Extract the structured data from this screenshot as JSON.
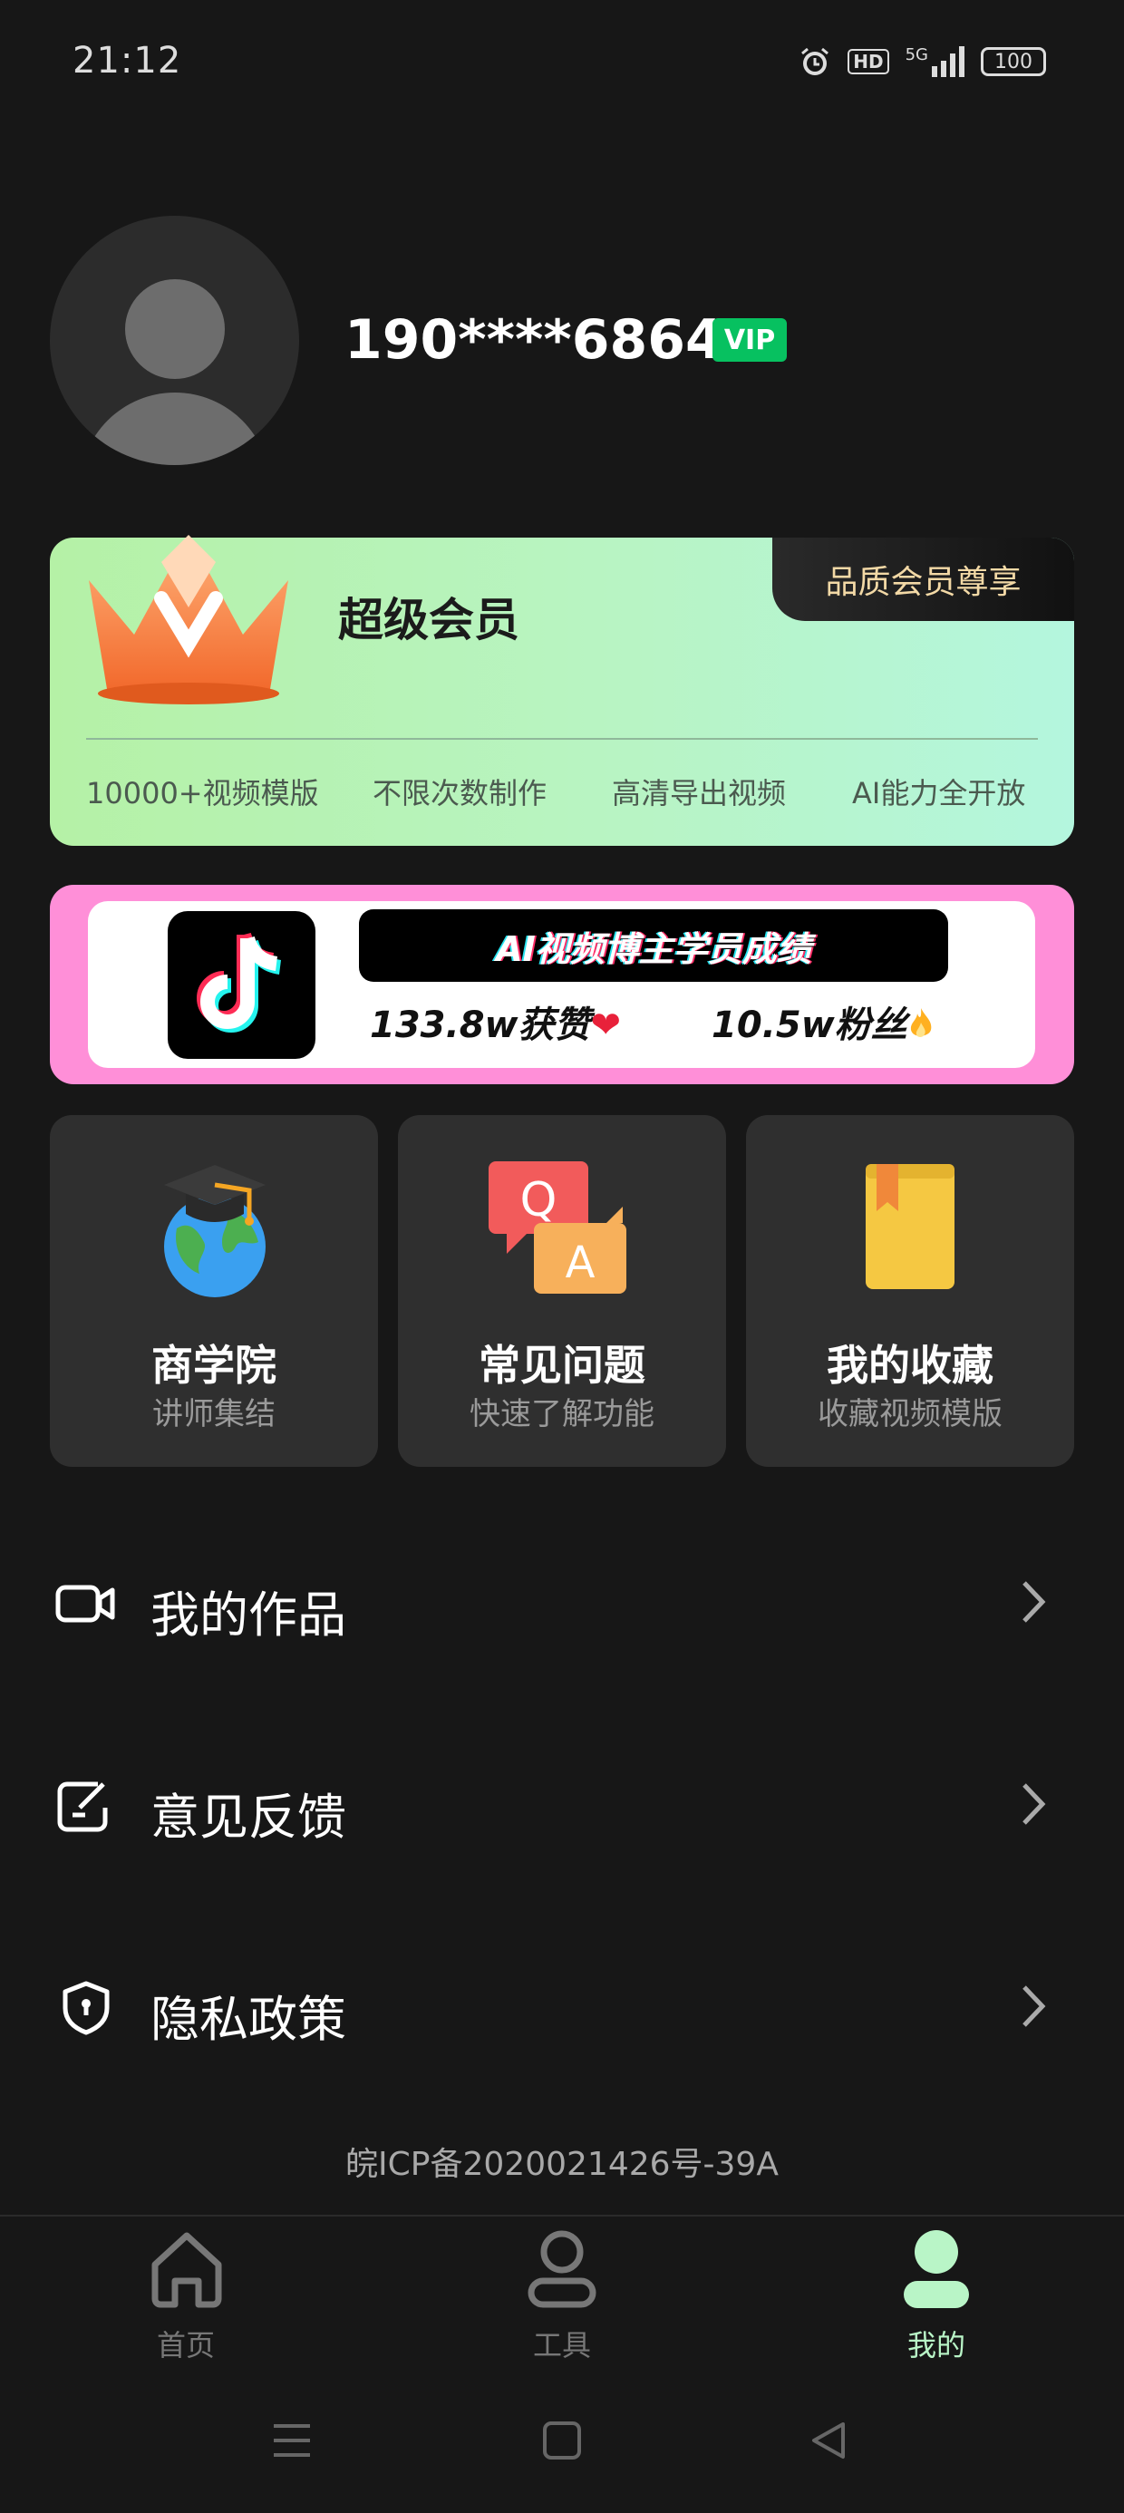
{
  "status_bar": {
    "time": "21:12",
    "hd": "HD",
    "network": "5G",
    "battery": "100"
  },
  "profile": {
    "username": "190****6864",
    "vip_badge": "VIP"
  },
  "member_card": {
    "title": "超级会员",
    "tag": "品质会员尊享",
    "features": [
      "10000+视频模版",
      "不限次数制作",
      "高清导出视频",
      "AI能力全开放"
    ]
  },
  "banner": {
    "headline": "AI视频博主学员成绩",
    "likes": "133.8w获赞",
    "fans": "10.5w粉丝"
  },
  "feature_cards": [
    {
      "title": "商学院",
      "subtitle": "讲师集结",
      "icon": "graduation-globe-icon"
    },
    {
      "title": "常见问题",
      "subtitle": "快速了解功能",
      "icon": "qa-icon"
    },
    {
      "title": "我的收藏",
      "subtitle": "收藏视频模版",
      "icon": "book-icon"
    }
  ],
  "menu": [
    {
      "label": "我的作品",
      "icon": "video-camera-icon"
    },
    {
      "label": "意见反馈",
      "icon": "feedback-edit-icon"
    },
    {
      "label": "隐私政策",
      "icon": "shield-icon"
    }
  ],
  "icp": "皖ICP备2020021426号-39A",
  "tab_bar": {
    "tabs": [
      "首页",
      "工具",
      "我的"
    ],
    "active": "我的",
    "active_color": "#b9f5c7",
    "inactive_color": "#777777"
  },
  "colors": {
    "background": "#171717",
    "vip_green": "#07c160",
    "banner_pink": "#ff8fd8"
  }
}
